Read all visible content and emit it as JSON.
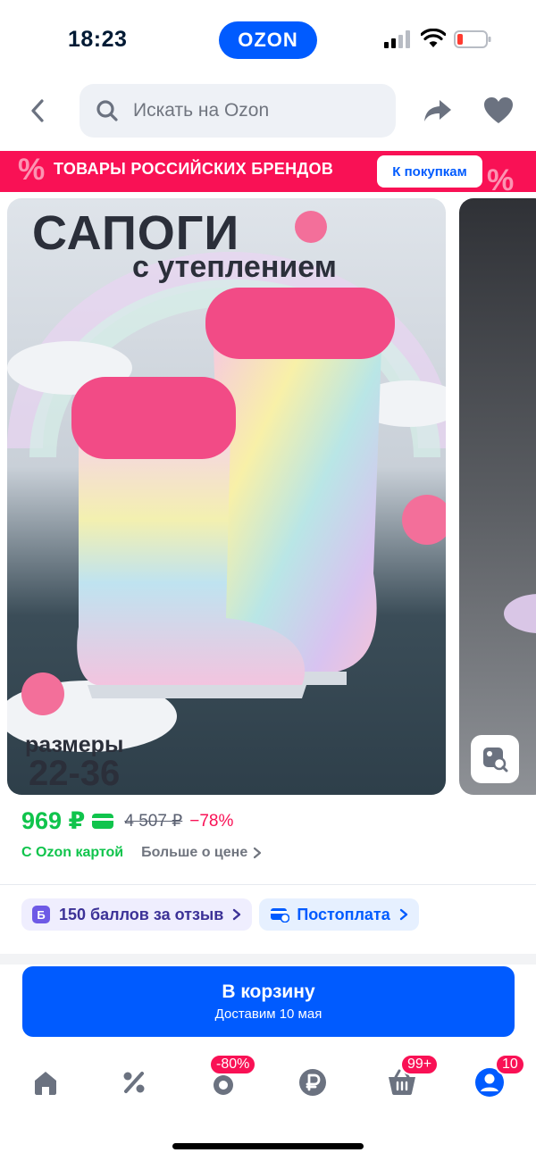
{
  "status_bar": {
    "time": "18:23",
    "logo": "OZON"
  },
  "search": {
    "placeholder": "Искать на Ozon"
  },
  "promo": {
    "text": "ТОВАРЫ РОССИЙСКИХ БРЕНДОВ",
    "button": "К покупкам",
    "color": "#f91155"
  },
  "gallery": {
    "title": "САПОГИ",
    "subtitle": "с утеплением",
    "sizes_label": "размеры",
    "sizes": "22-36"
  },
  "price": {
    "current": "969 ₽",
    "old": "4 507 ₽",
    "discount": "−78%",
    "with_card": "С Ozon картой",
    "more": "Больше о цене"
  },
  "chips": {
    "bonus": "150 баллов за отзыв",
    "bonus_icon_letter": "Б",
    "postpay": "Постоплата"
  },
  "cart": {
    "label": "В корзину",
    "delivery": "Доставим 10 мая"
  },
  "nav": {
    "sale_badge": "-80%",
    "cart_badge": "99+",
    "profile_badge": "10",
    "icons": [
      "home-icon",
      "discount-icon",
      "fresh-icon",
      "ruble-icon",
      "cart-icon",
      "profile-icon"
    ]
  },
  "colors": {
    "brand": "#005bff",
    "price_green": "#10c44c",
    "accent_pink": "#f91155"
  }
}
